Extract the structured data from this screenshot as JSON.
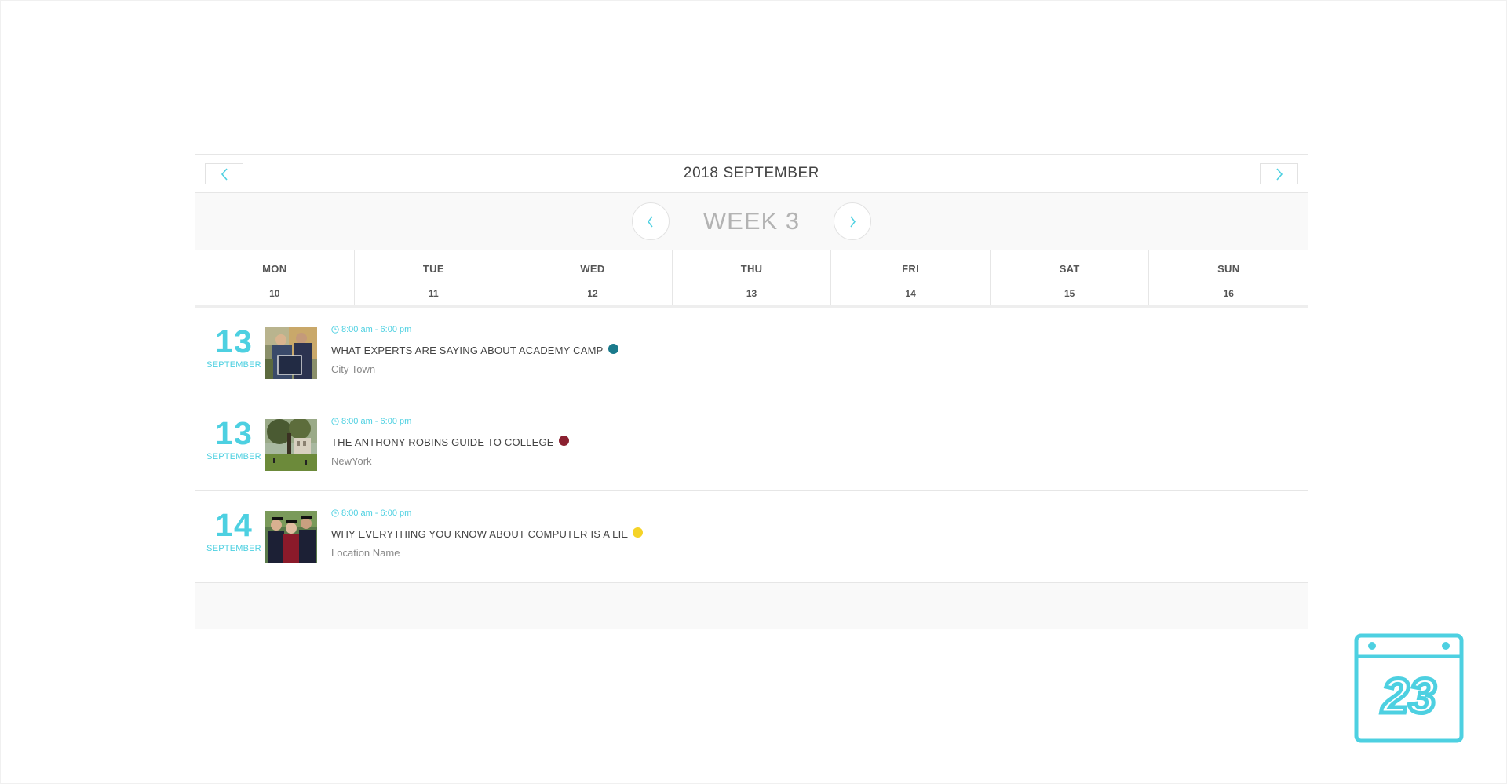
{
  "calendar": {
    "month_title": "2018 SEPTEMBER",
    "week_title": "WEEK 3",
    "days": [
      {
        "name": "MON",
        "num": "10"
      },
      {
        "name": "TUE",
        "num": "11"
      },
      {
        "name": "WED",
        "num": "12"
      },
      {
        "name": "THU",
        "num": "13"
      },
      {
        "name": "FRI",
        "num": "14"
      },
      {
        "name": "SAT",
        "num": "15"
      },
      {
        "name": "SUN",
        "num": "16"
      }
    ],
    "events": [
      {
        "day": "13",
        "month": "SEPTEMBER",
        "time": "8:00 am - 6:00 pm",
        "title": "WHAT EXPERTS ARE SAYING ABOUT ACADEMY CAMP",
        "dot_color": "#1a7a8c",
        "location": "City Town"
      },
      {
        "day": "13",
        "month": "SEPTEMBER",
        "time": "8:00 am - 6:00 pm",
        "title": "THE ANTHONY ROBINS GUIDE TO COLLEGE",
        "dot_color": "#8b2030",
        "location": "NewYork"
      },
      {
        "day": "14",
        "month": "SEPTEMBER",
        "time": "8:00 am - 6:00 pm",
        "title": "WHY EVERYTHING YOU KNOW ABOUT COMPUTER IS A LIE",
        "dot_color": "#f5d327",
        "location": "Location Name"
      }
    ]
  },
  "logo": {
    "number": "23",
    "color": "#4dd0e1"
  },
  "icons": {
    "prev": "chevron-left-icon",
    "next": "chevron-right-icon",
    "clock": "clock-icon"
  },
  "colors": {
    "accent": "#4dd0e1"
  }
}
